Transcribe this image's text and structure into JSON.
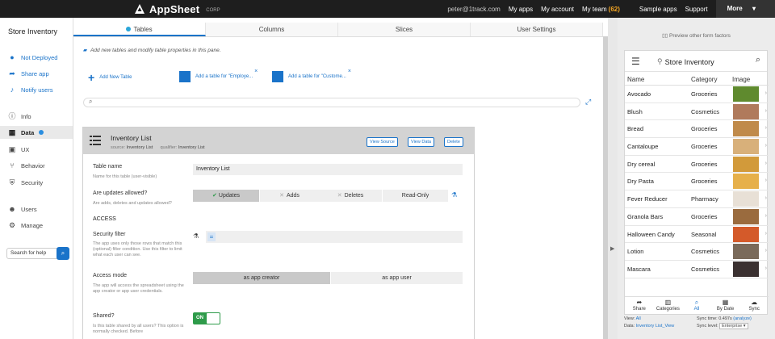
{
  "topbar": {
    "brand": "AppSheet",
    "corp": "CORP",
    "email": "peter@1track.com",
    "my_apps": "My apps",
    "my_account": "My account",
    "my_team": "My team",
    "team_count": "(62)",
    "sample_apps": "Sample apps",
    "support": "Support",
    "more": "More"
  },
  "sidebar": {
    "app_title": "Store Inventory",
    "items": [
      {
        "label": "Not Deployed",
        "icon": "alert-circle-icon"
      },
      {
        "label": "Share app",
        "icon": "share-icon"
      },
      {
        "label": "Notify users",
        "icon": "bell-icon"
      },
      {
        "label": "Info",
        "icon": "info-icon"
      },
      {
        "label": "Data",
        "icon": "grid-icon"
      },
      {
        "label": "UX",
        "icon": "image-icon"
      },
      {
        "label": "Behavior",
        "icon": "hierarchy-icon"
      },
      {
        "label": "Security",
        "icon": "shield-icon"
      },
      {
        "label": "Users",
        "icon": "users-icon"
      },
      {
        "label": "Manage",
        "icon": "gears-icon"
      }
    ],
    "search_placeholder": "Search for help"
  },
  "tabs": [
    "Tables",
    "Columns",
    "Slices",
    "User Settings"
  ],
  "main": {
    "hint": "Add new tables and modify table properties in this pane.",
    "add_new_table": "Add New Table",
    "add_employee": "Add a table for \"Employe...",
    "add_customer": "Add a table for \"Custome..."
  },
  "card": {
    "title": "Inventory List",
    "source_label": "source:",
    "source_value": "Inventory List",
    "qualifier_label": "qualifier:",
    "qualifier_value": "Inventory List",
    "btn_view_source": "View Source",
    "btn_view_data": "View Data",
    "btn_delete": "Delete",
    "table_name_label": "Table name",
    "table_name_desc": "Name for this table (user-visible)",
    "table_name_value": "Inventory List",
    "updates_label": "Are updates allowed?",
    "updates_desc": "Are adds, deletes and updates allowed?",
    "update_options": [
      "Updates",
      "Adds",
      "Deletes",
      "Read-Only"
    ],
    "access_section": "ACCESS",
    "security_filter_label": "Security filter",
    "security_filter_desc": "The app uses only those rows that match this (optional) filter condition. Use this filter to limit what each user can see.",
    "security_filter_value": "=",
    "access_mode_label": "Access mode",
    "access_mode_desc": "The app will access the spreadsheet using the app creator or app user credentials.",
    "access_modes": [
      "as app creator",
      "as app user"
    ],
    "shared_label": "Shared?",
    "shared_desc": "Is this table shared by all users? This option is normally checked. Before",
    "toggle_on": "ON"
  },
  "preview": {
    "note": "Preview other form factors",
    "app_title": "Store Inventory",
    "columns": [
      "Name",
      "Category",
      "Image"
    ],
    "rows": [
      {
        "name": "Avocado",
        "category": "Groceries",
        "img": "#5f8a2e"
      },
      {
        "name": "Blush",
        "category": "Cosmetics",
        "img": "#b07a5c"
      },
      {
        "name": "Bread",
        "category": "Groceries",
        "img": "#c08a4a"
      },
      {
        "name": "Cantaloupe",
        "category": "Groceries",
        "img": "#d8b07a"
      },
      {
        "name": "Dry cereal",
        "category": "Groceries",
        "img": "#d29a3a"
      },
      {
        "name": "Dry Pasta",
        "category": "Groceries",
        "img": "#e6b04a"
      },
      {
        "name": "Fever Reducer",
        "category": "Pharmacy",
        "img": "#e8e0d6"
      },
      {
        "name": "Granola Bars",
        "category": "Groceries",
        "img": "#9a6b3e"
      },
      {
        "name": "Halloween Candy",
        "category": "Seasonal",
        "img": "#d45a2a"
      },
      {
        "name": "Lotion",
        "category": "Cosmetics",
        "img": "#7a6a5a"
      },
      {
        "name": "Mascara",
        "category": "Cosmetics",
        "img": "#3a3030"
      }
    ],
    "footer": [
      {
        "label": "Share",
        "icon": "share-arrow-icon"
      },
      {
        "label": "Categories",
        "icon": "barcode-icon"
      },
      {
        "label": "All",
        "icon": "search-icon"
      },
      {
        "label": "By Date",
        "icon": "calendar-icon"
      },
      {
        "label": "Sync",
        "icon": "cloud-icon"
      }
    ],
    "view_label": "View:",
    "view_value": "All",
    "data_label": "Data:",
    "data_value": "Inventory List_View",
    "sync_time_label": "Sync time: 0.497s",
    "analyze": "(analyze)",
    "sync_level_label": "Sync level:",
    "sync_level_value": "Enterprise"
  }
}
